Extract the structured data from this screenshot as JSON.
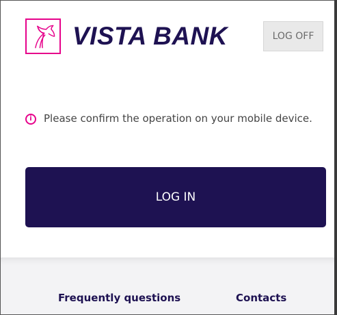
{
  "header": {
    "brand_name": "VISTA BANK",
    "logo_icon": "horse-head-icon",
    "logoff_label": "LOG OFF"
  },
  "notice": {
    "icon": "info-icon",
    "text": "Please confirm the operation on your mobile device."
  },
  "login": {
    "button_label": "LOG IN"
  },
  "footer": {
    "links": [
      {
        "label": "Frequently questions"
      },
      {
        "label": "Contacts"
      }
    ]
  },
  "colors": {
    "brand_navy": "#1e1252",
    "accent_magenta": "#e6008a",
    "logoff_bg": "#e9e9e9",
    "footer_bg": "#f3f3f5"
  }
}
